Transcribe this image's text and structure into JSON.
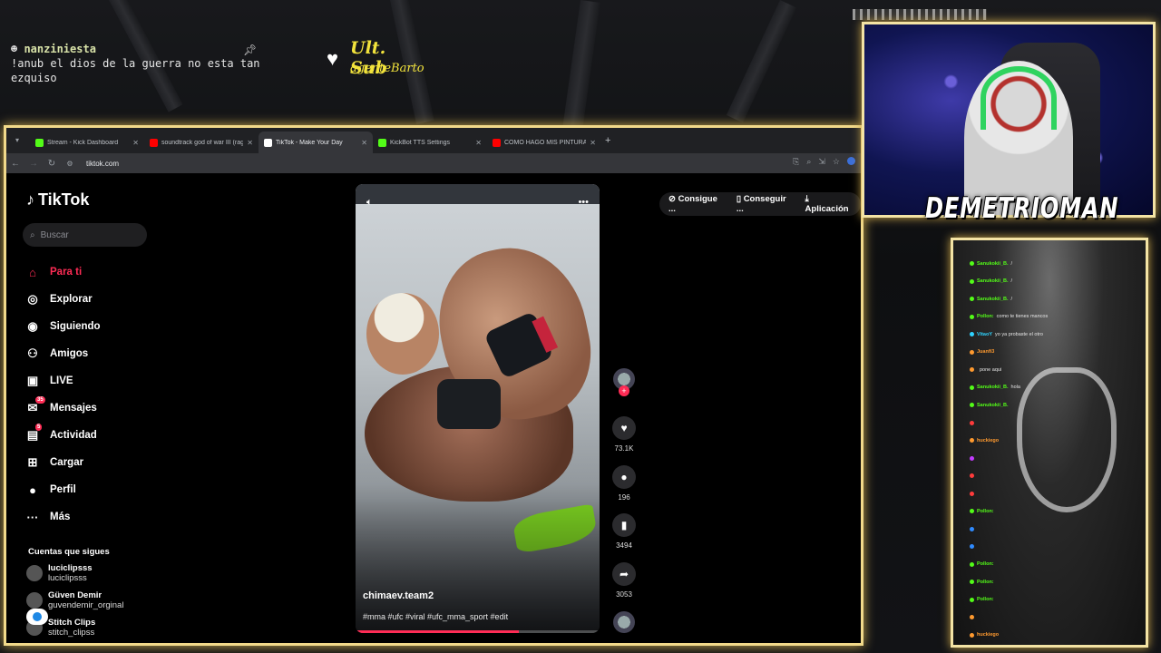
{
  "overlay": {
    "chat_user": "nanziniesta",
    "chat_message": "!anub el dios de la guerra no esta tan ezquiso",
    "ult_sub_label": "Ult. Sub",
    "ult_sub_user": "agenteBarto",
    "streamer_name": "DEMETRIOMAN"
  },
  "browser": {
    "tabs": [
      {
        "label": "Stream - Kick Dashboard",
        "color": "#53fc18"
      },
      {
        "label": "soundtrack god of war III (rage",
        "color": "#ff0000"
      },
      {
        "label": "TikTok - Make Your Day",
        "color": "#ffffff"
      },
      {
        "label": "KickBot TTS Settings",
        "color": "#53fc18"
      },
      {
        "label": "COMO HAGO MIS PINTURAS",
        "color": "#ff0000"
      }
    ],
    "active_tab": 2,
    "url": "tiktok.com"
  },
  "tiktok": {
    "logo": "TikTok",
    "search_placeholder": "Buscar",
    "nav": [
      {
        "label": "Para ti",
        "icon": "home-icon",
        "active": true
      },
      {
        "label": "Explorar",
        "icon": "compass-icon"
      },
      {
        "label": "Siguiendo",
        "icon": "following-icon"
      },
      {
        "label": "Amigos",
        "icon": "friends-icon"
      },
      {
        "label": "LIVE",
        "icon": "live-icon"
      },
      {
        "label": "Mensajes",
        "icon": "messages-icon",
        "badge": "35"
      },
      {
        "label": "Actividad",
        "icon": "activity-icon",
        "badge": "5"
      },
      {
        "label": "Cargar",
        "icon": "upload-icon"
      },
      {
        "label": "Perfil",
        "icon": "profile-icon"
      },
      {
        "label": "Más",
        "icon": "more-icon"
      }
    ],
    "following_header": "Cuentas que sigues",
    "following": [
      {
        "name": "luciclipsss",
        "handle": "luciclipsss"
      },
      {
        "name": "Güven Demir",
        "handle": "guvendemir_orginal"
      },
      {
        "name": "Stitch Clips",
        "handle": "stitch_clipss"
      }
    ],
    "top_buttons": [
      "Consigue ...",
      "Conseguir ...",
      "Aplicación"
    ],
    "video": {
      "author": "chimaev.team2",
      "tags": "#mma #ufc #viral #ufc_mma_sport #edit",
      "progress": 0.67,
      "likes": "73.1K",
      "comments": "196",
      "saves": "3494",
      "shares": "3053"
    }
  },
  "chat_panel": {
    "lines": [
      {
        "user": "Sanukokii_B.",
        "msg": "/",
        "color": "#53fc18"
      },
      {
        "user": "Sanukokii_B.",
        "msg": "/",
        "color": "#53fc18"
      },
      {
        "user": "Sanukokii_B.",
        "msg": "/",
        "color": "#53fc18"
      },
      {
        "user": "Pollon:",
        "msg": "como te tienes mancos",
        "color": "#53fc18"
      },
      {
        "user": "VitaoY",
        "msg": "yo ya probaste el otro",
        "color": "#2fd3ff"
      },
      {
        "user": "Juanfi3",
        "msg": "",
        "color": "#ff9a2f"
      },
      {
        "user": "",
        "msg": "pone aqui",
        "color": "#ff9a2f"
      },
      {
        "user": "Sanukokii_B.",
        "msg": "hola",
        "color": "#53fc18"
      },
      {
        "user": "Sanukokii_B.",
        "msg": "",
        "color": "#53fc18"
      },
      {
        "user": "",
        "msg": "",
        "color": "#ff3b3b"
      },
      {
        "user": "huckiego",
        "msg": "",
        "color": "#ff9a2f"
      },
      {
        "user": "",
        "msg": "",
        "color": "#c43bff"
      },
      {
        "user": "",
        "msg": "",
        "color": "#ff3b3b"
      },
      {
        "user": "",
        "msg": "",
        "color": "#ff3b3b"
      },
      {
        "user": "Pollon:",
        "msg": "",
        "color": "#53fc18"
      },
      {
        "user": "",
        "msg": "",
        "color": "#2f8bff"
      },
      {
        "user": "",
        "msg": "",
        "color": "#2f8bff"
      },
      {
        "user": "Pollon:",
        "msg": "",
        "color": "#53fc18"
      },
      {
        "user": "Pollon:",
        "msg": "",
        "color": "#53fc18"
      },
      {
        "user": "Pollon:",
        "msg": "",
        "color": "#53fc18"
      },
      {
        "user": "",
        "msg": "",
        "color": "#ff9a2f"
      },
      {
        "user": "huckiego",
        "msg": "",
        "color": "#ff9a2f"
      },
      {
        "user": "Pollon:",
        "msg": "",
        "color": "#53fc18"
      }
    ]
  }
}
